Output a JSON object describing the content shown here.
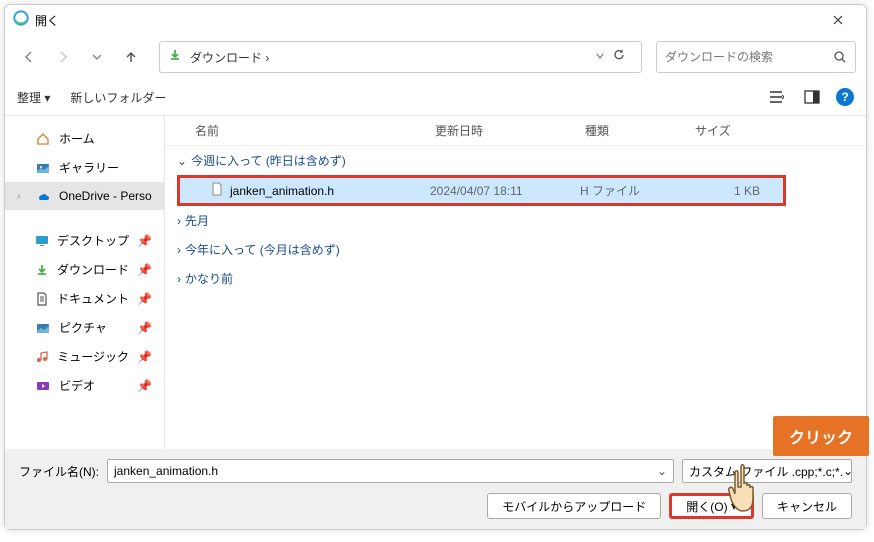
{
  "window": {
    "title": "開く"
  },
  "nav": {
    "path": "ダウンロード  ›"
  },
  "search": {
    "placeholder": "ダウンロードの検索"
  },
  "toolbar": {
    "organize": "整理 ▾",
    "new_folder": "新しいフォルダー"
  },
  "sidebar": {
    "home": "ホーム",
    "gallery": "ギャラリー",
    "onedrive": "OneDrive - Perso",
    "desktop": "デスクトップ",
    "downloads": "ダウンロード",
    "documents": "ドキュメント",
    "pictures": "ピクチャ",
    "music": "ミュージック",
    "videos": "ビデオ"
  },
  "headers": {
    "name": "名前",
    "date": "更新日時",
    "type": "種類",
    "size": "サイズ"
  },
  "groups": {
    "this_week": "今週に入って (昨日は含めず)",
    "last_month": "先月",
    "this_year": "今年に入って (今月は含めず)",
    "long_ago": "かなり前"
  },
  "file": {
    "name": "janken_animation.h",
    "date": "2024/04/07 18:11",
    "type": "H ファイル",
    "size": "1 KB"
  },
  "footer": {
    "filename_label": "ファイル名(N):",
    "filename_value": "janken_animation.h",
    "filter": "カスタム ファイル          .cpp;*.c;*. ",
    "upload": "モバイルからアップロード",
    "open": "開く(O)",
    "cancel": "キャンセル"
  },
  "overlay": {
    "click": "クリック"
  }
}
